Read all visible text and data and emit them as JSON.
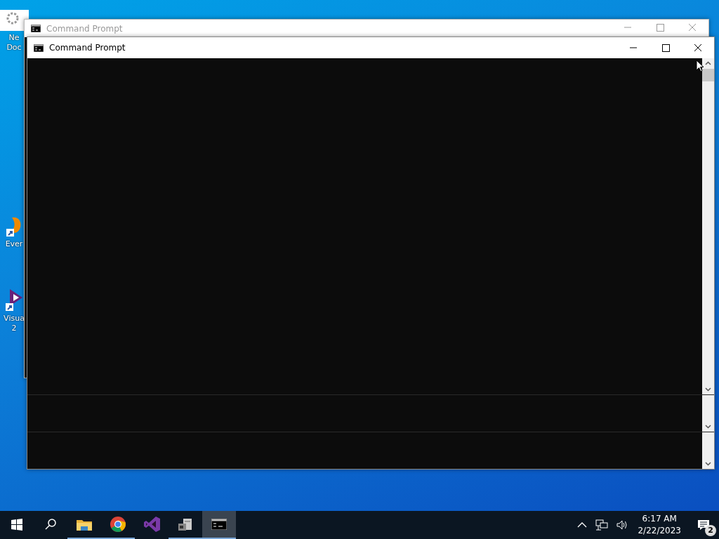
{
  "desktop_icons": [
    {
      "kind": "document",
      "lines": [
        "Ne",
        "Doc"
      ]
    },
    {
      "kind": "evernote",
      "lines": [
        "Ever"
      ]
    },
    {
      "kind": "visualstudio",
      "lines": [
        "Visua",
        "2"
      ]
    }
  ],
  "windows": [
    {
      "title": "Command Prompt",
      "active": false
    },
    {
      "title": "Command Prompt",
      "active": true
    }
  ],
  "taskbar": {
    "apps": [
      {
        "kind": "start",
        "running": false,
        "active": false
      },
      {
        "kind": "search",
        "running": false,
        "active": false
      },
      {
        "kind": "explorer",
        "running": true,
        "active": false
      },
      {
        "kind": "chrome",
        "running": true,
        "active": false
      },
      {
        "kind": "visualstudio",
        "running": false,
        "active": false
      },
      {
        "kind": "app",
        "running": true,
        "active": false
      },
      {
        "kind": "console",
        "running": true,
        "active": true
      }
    ],
    "time": "6:17 AM",
    "date": "2/22/2023",
    "notifications": "2"
  }
}
